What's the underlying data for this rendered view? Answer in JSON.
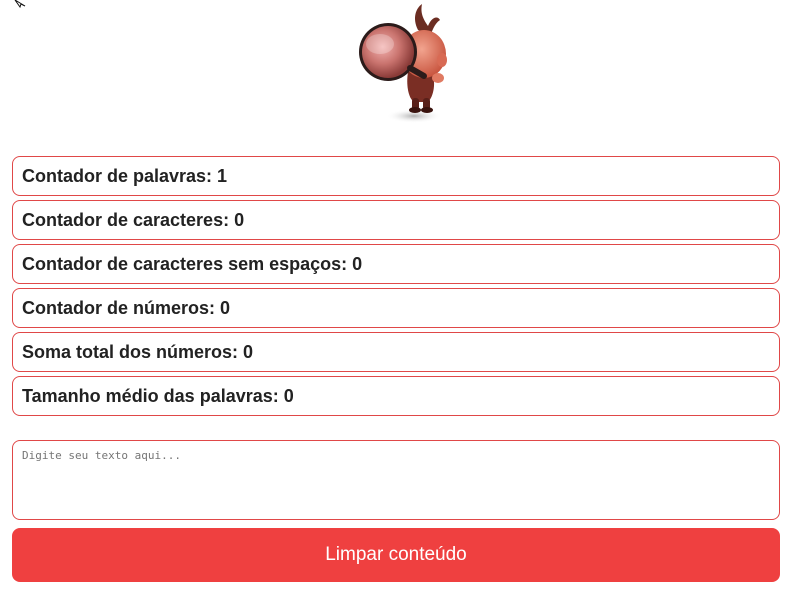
{
  "stats": [
    {
      "label": "Contador de palavras: 1"
    },
    {
      "label": "Contador de caracteres: 0"
    },
    {
      "label": "Contador de caracteres sem espaços: 0"
    },
    {
      "label": "Contador de números: 0"
    },
    {
      "label": "Soma total dos números: 0"
    },
    {
      "label": "Tamanho médio das palavras: 0"
    }
  ],
  "input": {
    "value": "",
    "placeholder": "Digite seu texto aqui..."
  },
  "actions": {
    "clear_label": "Limpar conteúdo"
  },
  "colors": {
    "accent": "#ef4040",
    "border": "#e04848",
    "text": "#222222"
  },
  "icons": {
    "cursor": "mouse-pointer-icon",
    "mascot": "magnifying-glass-mascot-icon"
  }
}
